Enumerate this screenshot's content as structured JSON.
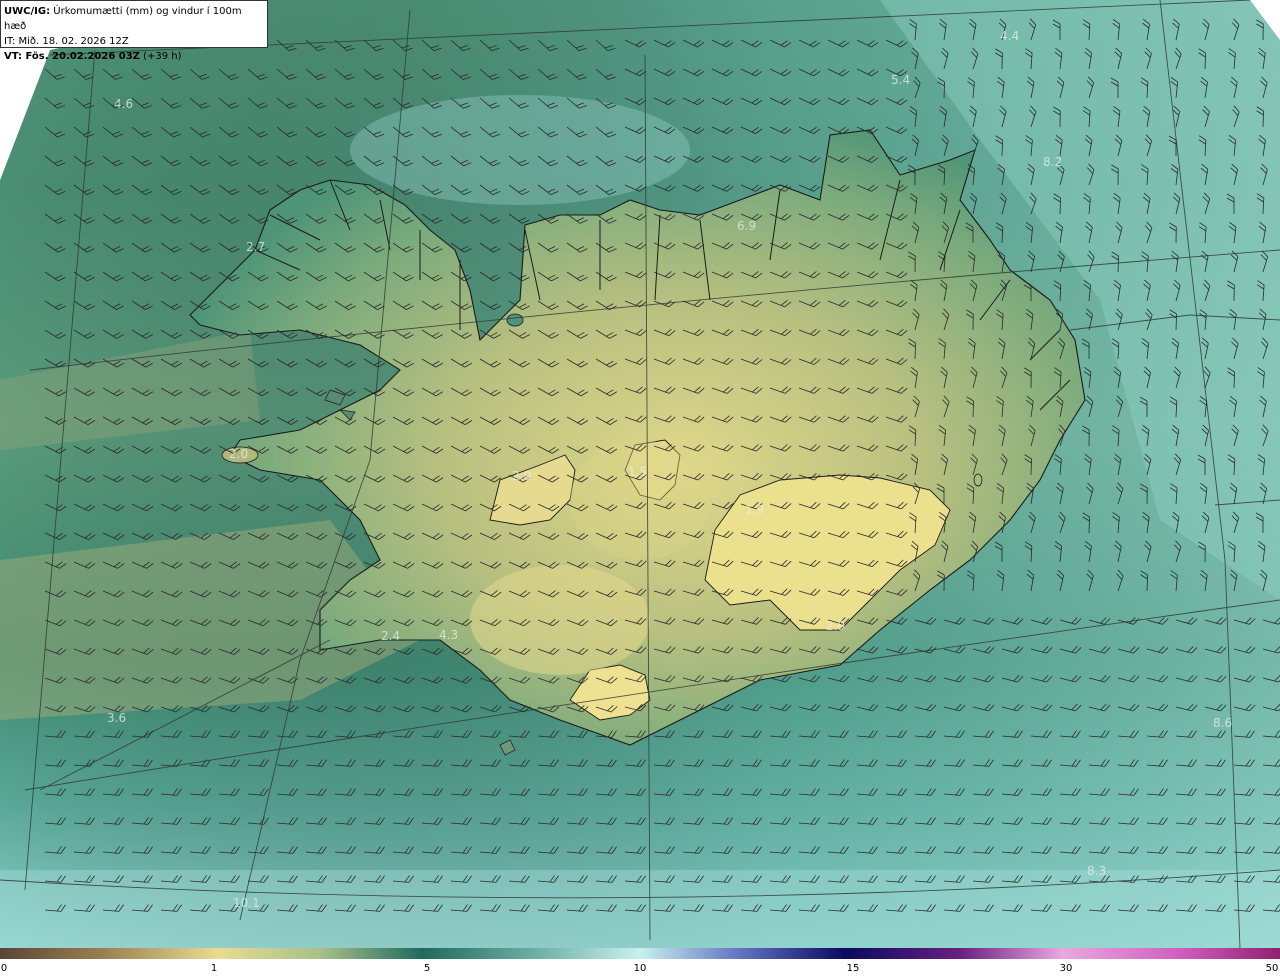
{
  "title": {
    "prefix": "UWC/IG:",
    "description": "Úrkomumætti (mm) og vindur í 100m hæð",
    "init_time": "IT: Mið. 18. 02. 2026 12Z",
    "valid_prefix": "VT: Fös. 20.02.2026 03Z",
    "valid_offset": "(+39 h)"
  },
  "map_values": [
    "4.6",
    "2.7",
    "4.4",
    "5.4",
    "8.2",
    "6.9",
    "2.0",
    "2.4",
    "4.3",
    "3.6",
    "8.6",
    "8.3",
    "10.1",
    "1.5",
    "1.9",
    "2.9",
    "2.0"
  ],
  "colorbar": {
    "ticks": [
      "0",
      "1",
      "5",
      "10",
      "15",
      "30",
      "50"
    ],
    "colors": [
      "#5b4636",
      "#8a7248",
      "#c8b070",
      "#e8dc90",
      "#a8c08a",
      "#3c8a72",
      "#1f6a5c",
      "#6fb0a8",
      "#b8e8e8",
      "#c8e8f0",
      "#3040a0",
      "#0a0a60",
      "#702080",
      "#e8a0d8",
      "#c040b0",
      "#902070"
    ]
  }
}
